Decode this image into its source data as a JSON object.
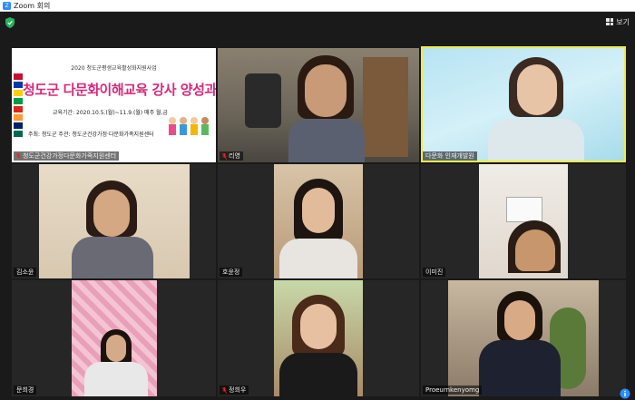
{
  "window": {
    "title": "Zoom 회의",
    "app_icon": "Z"
  },
  "topbar": {
    "view_label": "보기"
  },
  "slide": {
    "line1": "2020 청도군평생교육활성화지원사업",
    "title": "청도군 다문화이해교육 강사 양성과정",
    "period": "교육기간: 2020.10.5.(월)~11.9.(월) 매주 월,금",
    "organizers": "주최: 청도군   주관: 청도군건강가정·다문화가족지원센터"
  },
  "tiles": [
    {
      "name": "청도군건강가정다문화가족지원센터",
      "muted": true
    },
    {
      "name": "리영",
      "muted": true
    },
    {
      "name": "다문화 인재개발원",
      "muted": false,
      "active": true
    },
    {
      "name": "김소윤",
      "muted": false
    },
    {
      "name": "호윤정",
      "muted": false
    },
    {
      "name": "이미진",
      "muted": false
    },
    {
      "name": "문희경",
      "muted": false
    },
    {
      "name": "정희우",
      "muted": true
    },
    {
      "name": "Proeurnkenyomg",
      "muted": false
    }
  ],
  "colors": {
    "active_border": "#ecec4c",
    "background": "#1a1a1a",
    "mute_red": "#e02828",
    "slide_title": "#d8287a"
  }
}
